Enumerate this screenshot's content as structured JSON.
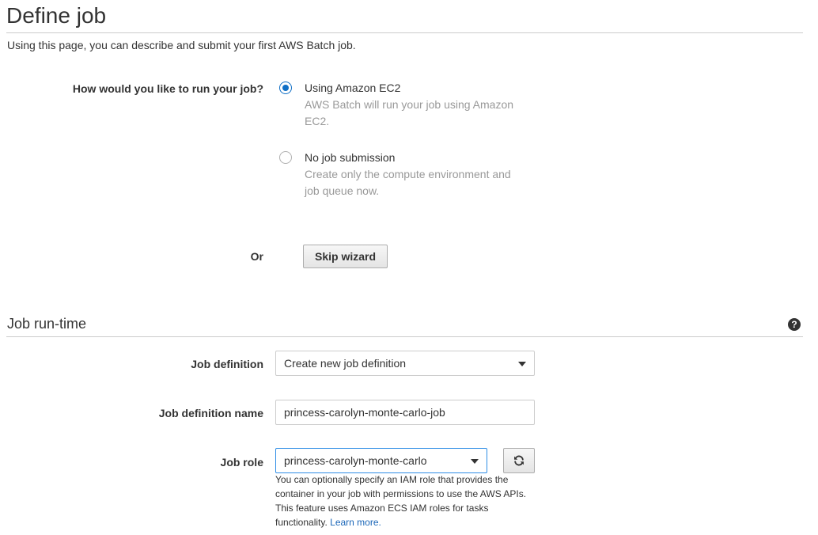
{
  "page": {
    "title": "Define job",
    "description": "Using this page, you can describe and submit your first AWS Batch job."
  },
  "run_question": {
    "label": "How would you like to run your job?",
    "options": [
      {
        "title": "Using Amazon EC2",
        "description": "AWS Batch will run your job using Amazon EC2.",
        "selected": true
      },
      {
        "title": "No job submission",
        "description": "Create only the compute environment and job queue now.",
        "selected": false
      }
    ]
  },
  "skip": {
    "or_label": "Or",
    "button_label": "Skip wizard"
  },
  "runtime": {
    "section_title": "Job run-time",
    "help_icon": "question-circle-icon",
    "job_definition": {
      "label": "Job definition",
      "value": "Create new job definition"
    },
    "job_definition_name": {
      "label": "Job definition name",
      "value": "princess-carolyn-monte-carlo-job"
    },
    "job_role": {
      "label": "Job role",
      "value": "princess-carolyn-monte-carlo",
      "refresh_icon": "refresh-icon",
      "hint": "You can optionally specify an IAM role that provides the container in your job with permissions to use the AWS APIs. This feature uses Amazon ECS IAM roles for tasks functionality.",
      "learn_more": "Learn more."
    }
  },
  "colors": {
    "accent": "#0f6fc6",
    "link": "#1a66b8",
    "muted_text": "#999999",
    "focus_border": "#2f8ee6"
  }
}
